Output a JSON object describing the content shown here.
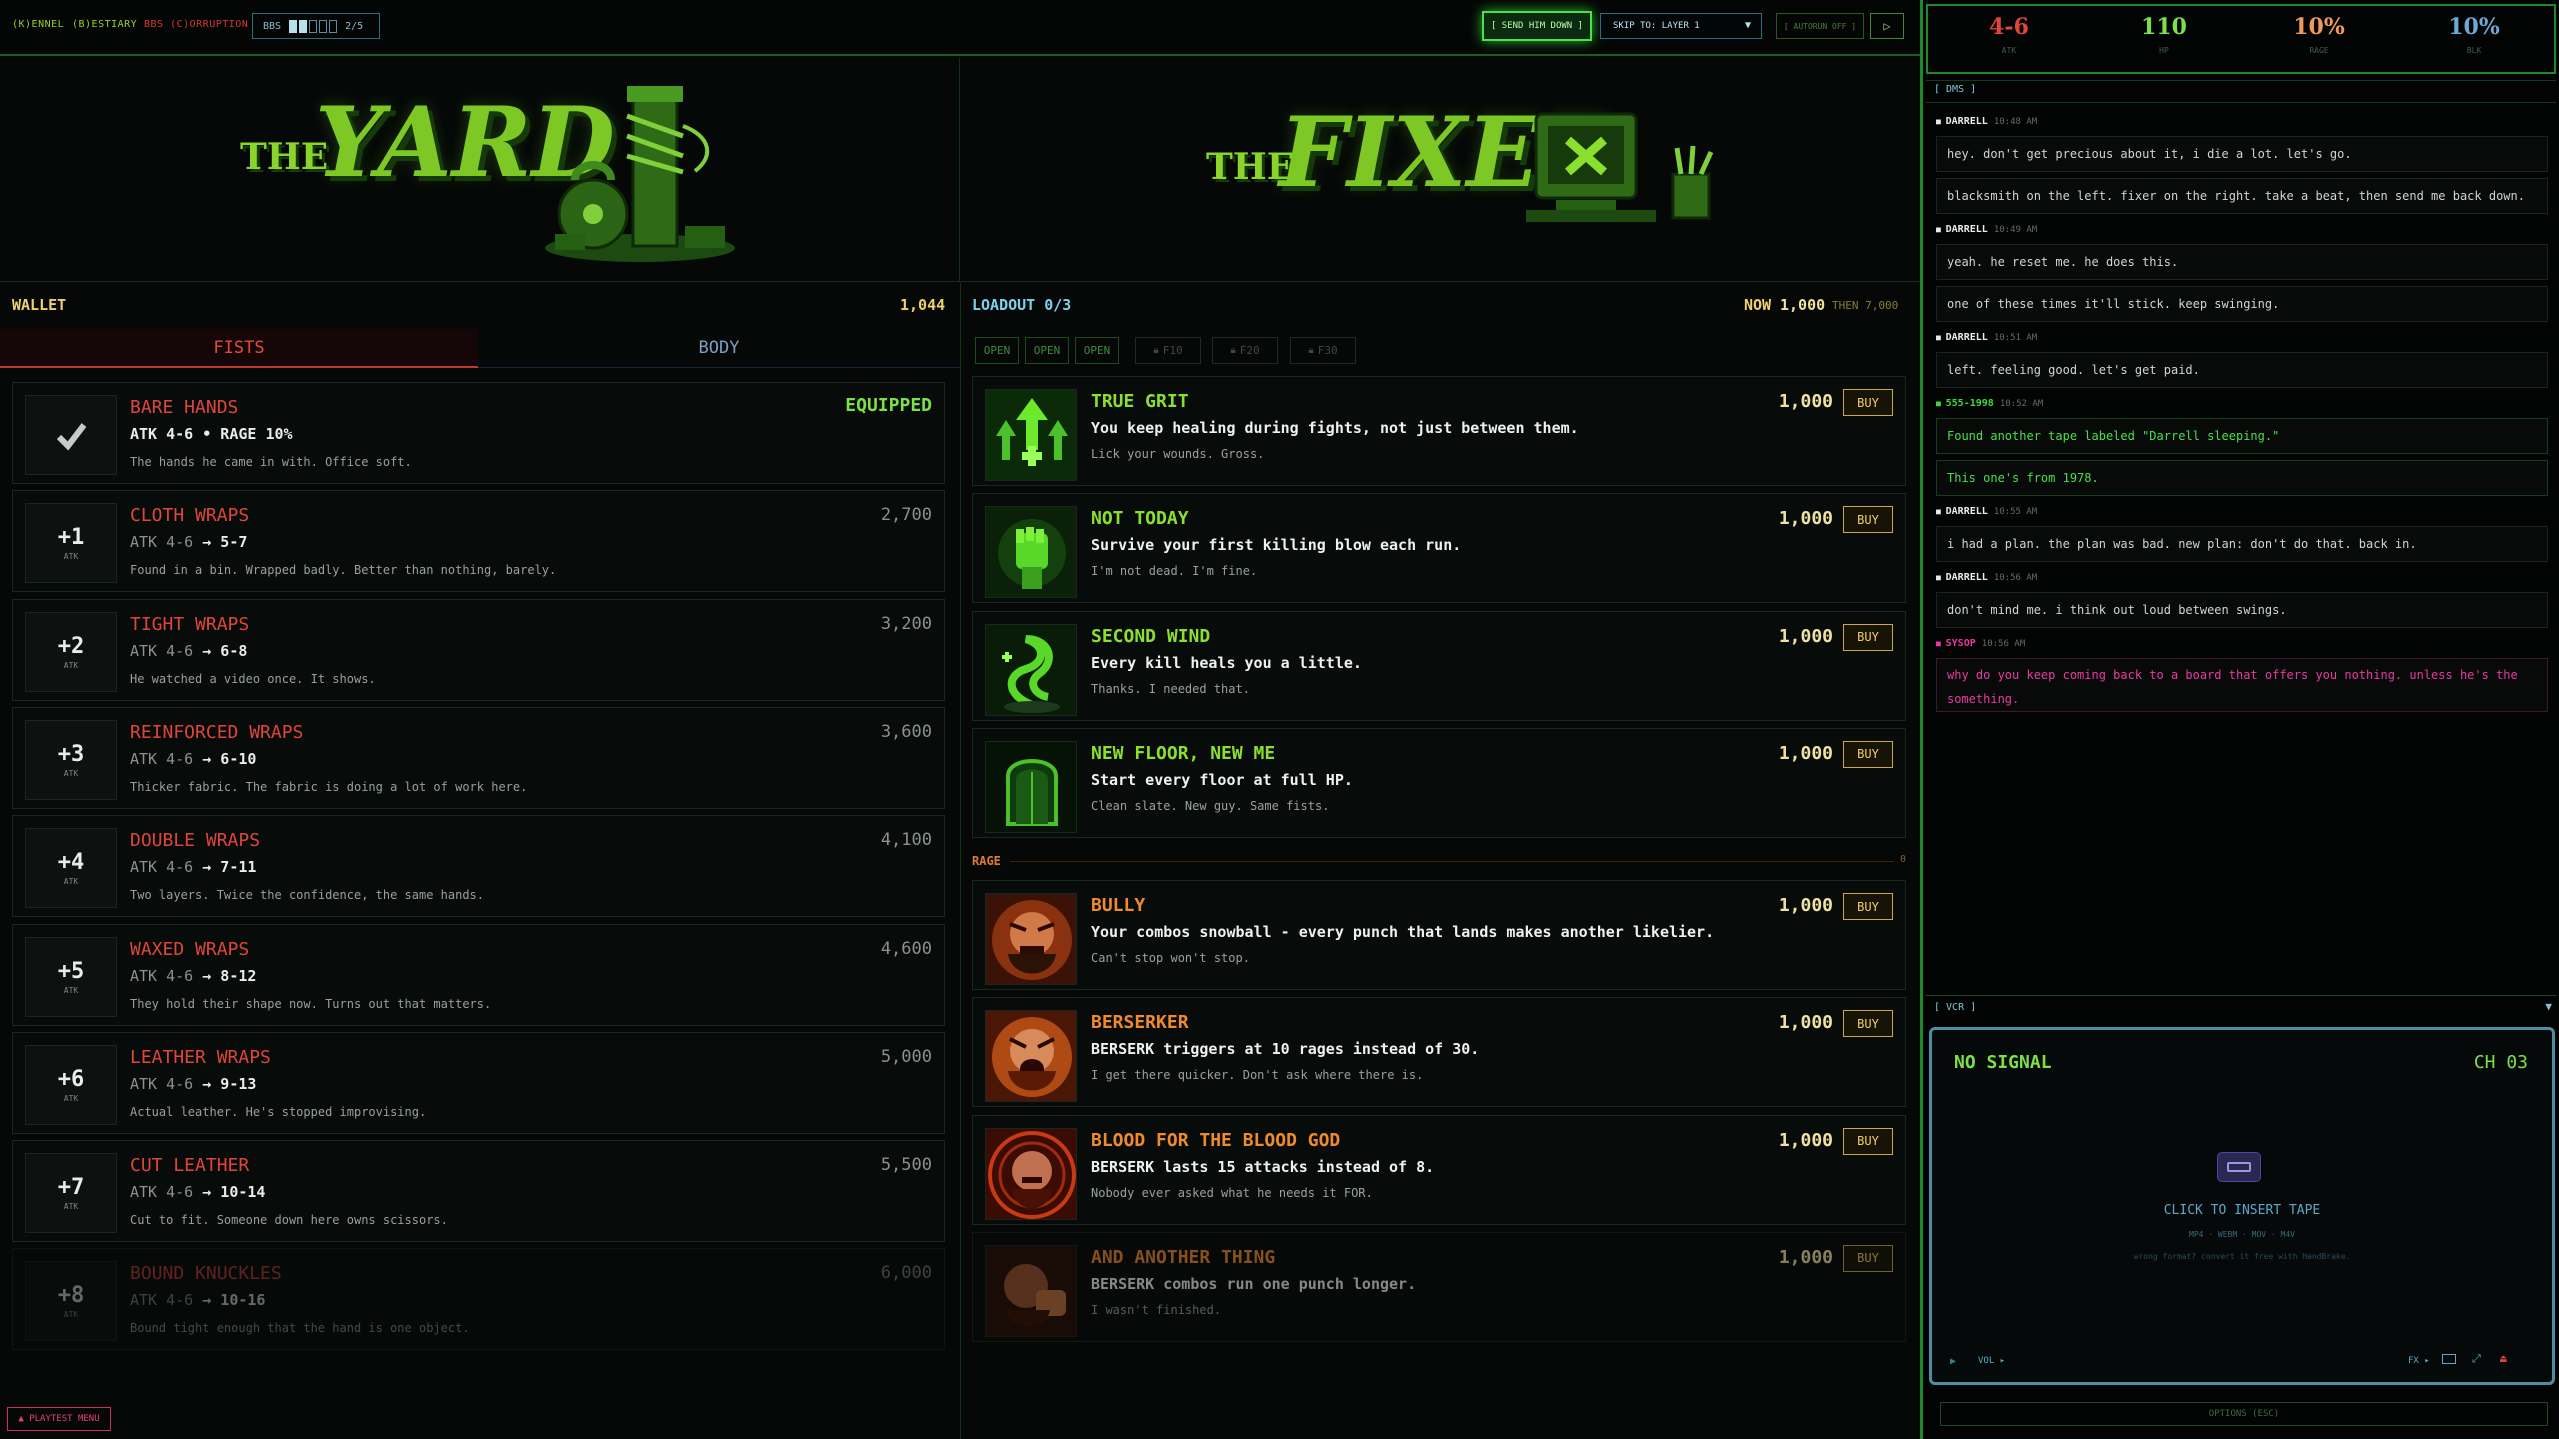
{
  "topbar": {
    "menu": [
      {
        "label": "(K)ENNEL",
        "color": "green"
      },
      {
        "label": "(B)ESTIARY",
        "color": "green"
      },
      {
        "label": "BBS (C)ORRUPTION",
        "color": "red"
      }
    ],
    "bbs_label": "BBS",
    "bbs_level": "2/5",
    "bbs_filled": 2,
    "bbs_total": 5,
    "send_button": "[ SEND HIM DOWN ]",
    "skip_select": "SKIP TO: LAYER 1",
    "autorun": "[ AUTORUN OFF ]",
    "play_icon": "play-icon"
  },
  "banners": {
    "left": {
      "the": "THE",
      "title": "YARD"
    },
    "right": {
      "the": "THE",
      "title": "FIXER"
    }
  },
  "wallet": {
    "label": "WALLET",
    "amount": "1,044"
  },
  "tabs": {
    "fists": "FISTS",
    "body": "BODY"
  },
  "weapons": [
    {
      "name": "BARE HANDS",
      "stat": "ATK 4-6 • RAGE 10%",
      "old": "",
      "new": "",
      "desc": "The hands he came in with. Office soft.",
      "price": "",
      "status": "EQUIPPED",
      "icon": "check-icon",
      "plus": "",
      "sub": ""
    },
    {
      "name": "CLOTH WRAPS",
      "stat": "",
      "old": "ATK 4-6",
      "new": "→ 5-7",
      "desc": "Found in a bin. Wrapped badly. Better than nothing, barely.",
      "price": "2,700",
      "status": "",
      "plus": "+1",
      "sub": "ATK"
    },
    {
      "name": "TIGHT WRAPS",
      "stat": "",
      "old": "ATK 4-6",
      "new": "→ 6-8",
      "desc": "He watched a video once. It shows.",
      "price": "3,200",
      "status": "",
      "plus": "+2",
      "sub": "ATK"
    },
    {
      "name": "REINFORCED WRAPS",
      "stat": "",
      "old": "ATK 4-6",
      "new": "→ 6-10",
      "desc": "Thicker fabric. The fabric is doing a lot of work here.",
      "price": "3,600",
      "status": "",
      "plus": "+3",
      "sub": "ATK"
    },
    {
      "name": "DOUBLE WRAPS",
      "stat": "",
      "old": "ATK 4-6",
      "new": "→ 7-11",
      "desc": "Two layers. Twice the confidence, the same hands.",
      "price": "4,100",
      "status": "",
      "plus": "+4",
      "sub": "ATK"
    },
    {
      "name": "WAXED WRAPS",
      "stat": "",
      "old": "ATK 4-6",
      "new": "→ 8-12",
      "desc": "They hold their shape now. Turns out that matters.",
      "price": "4,600",
      "status": "",
      "plus": "+5",
      "sub": "ATK"
    },
    {
      "name": "LEATHER WRAPS",
      "stat": "",
      "old": "ATK 4-6",
      "new": "→ 9-13",
      "desc": "Actual leather. He's stopped improvising.",
      "price": "5,000",
      "status": "",
      "plus": "+6",
      "sub": "ATK"
    },
    {
      "name": "CUT LEATHER",
      "stat": "",
      "old": "ATK 4-6",
      "new": "→ 10-14",
      "desc": "Cut to fit. Someone down here owns scissors.",
      "price": "5,500",
      "status": "",
      "plus": "+7",
      "sub": "ATK"
    },
    {
      "name": "BOUND KNUCKLES",
      "stat": "",
      "old": "ATK 4-6",
      "new": "→ 10-16",
      "desc": "Bound tight enough that the hand is one object.",
      "price": "6,000",
      "status": "",
      "plus": "+8",
      "sub": "ATK"
    }
  ],
  "loadout": {
    "label": "LOADOUT 0/3",
    "now_label": "NOW",
    "now_amount": "1,000",
    "then": "THEN 7,000",
    "slots": [
      {
        "label": "OPEN",
        "locked": false
      },
      {
        "label": "OPEN",
        "locked": false
      },
      {
        "label": "OPEN",
        "locked": false
      },
      {
        "label": "F10",
        "locked": true
      },
      {
        "label": "F20",
        "locked": true
      },
      {
        "label": "F30",
        "locked": true
      }
    ]
  },
  "perks": [
    {
      "name": "TRUE GRIT",
      "desc": "You keep healing during fights, not just between them.",
      "flavor": "Lick your wounds. Gross.",
      "price": "1,000",
      "buy": "BUY",
      "kind": "green",
      "icon": "heal-arrows-icon"
    },
    {
      "name": "NOT TODAY",
      "desc": "Survive your first killing blow each run.",
      "flavor": "I'm not dead. I'm fine.",
      "price": "1,000",
      "buy": "BUY",
      "kind": "green",
      "icon": "raised-fist-icon"
    },
    {
      "name": "SECOND WIND",
      "desc": "Every kill heals you a little.",
      "flavor": "Thanks. I needed that.",
      "price": "1,000",
      "buy": "BUY",
      "kind": "green",
      "icon": "wind-swirl-icon"
    },
    {
      "name": "NEW FLOOR, NEW ME",
      "desc": "Start every floor at full HP.",
      "flavor": "Clean slate. New guy. Same fists.",
      "price": "1,000",
      "buy": "BUY",
      "kind": "green",
      "icon": "doorway-icon"
    }
  ],
  "rage_section": {
    "label": "RAGE",
    "count": "0"
  },
  "rage_perks": [
    {
      "name": "BULLY",
      "desc": "Your combos snowball - every punch that lands makes another likelier.",
      "flavor": "Can't stop won't stop.",
      "price": "1,000",
      "buy": "BUY",
      "icon": "angry-face-icon"
    },
    {
      "name": "BERSERKER",
      "desc": "BERSERK triggers at 10 rages instead of 30.",
      "flavor": "I get there quicker. Don't ask where there is.",
      "price": "1,000",
      "buy": "BUY",
      "icon": "screaming-face-icon"
    },
    {
      "name": "BLOOD FOR THE BLOOD GOD",
      "desc": "BERSERK lasts 15 attacks instead of 8.",
      "flavor": "Nobody ever asked what he needs it FOR.",
      "price": "1,000",
      "buy": "BUY",
      "icon": "blood-face-icon"
    },
    {
      "name": "AND ANOTHER THING",
      "desc": "BERSERK combos run one punch longer.",
      "flavor": "I wasn't finished.",
      "price": "1,000",
      "buy": "BUY",
      "icon": "punch-face-icon"
    }
  ],
  "stats": [
    {
      "value": "4-6",
      "label": "ATK",
      "color": "#e0453a"
    },
    {
      "value": "110",
      "label": "HP",
      "color": "#7ce04a"
    },
    {
      "value": "10%",
      "label": "RAGE",
      "color": "#f09a5a"
    },
    {
      "value": "10%",
      "label": "BLK",
      "color": "#6fa8d8"
    }
  ],
  "dms": {
    "header": "[ DMS ]",
    "groups": [
      {
        "name": "DARRELL",
        "time": "10:48 AM",
        "nameColor": "#e6ece6",
        "messages": [
          "hey. don't get precious about it, i die a lot. let's go.",
          "blacksmith on the left. fixer on the right. take a beat, then send me back down."
        ]
      },
      {
        "name": "DARRELL",
        "time": "10:49 AM",
        "nameColor": "#e6ece6",
        "messages": [
          "yeah. he reset me. he does this.",
          "one of these times it'll stick. keep swinging."
        ]
      },
      {
        "name": "DARRELL",
        "time": "10:51 AM",
        "nameColor": "#e6ece6",
        "messages": [
          "left. feeling good. let's get paid."
        ]
      },
      {
        "name": "555-1998",
        "time": "10:52 AM",
        "nameColor": "#3fd83c",
        "messages": [
          "Found another tape labeled \"Darrell sleeping.\"",
          "This one's from 1978."
        ]
      },
      {
        "name": "DARRELL",
        "time": "10:55 AM",
        "nameColor": "#e6ece6",
        "messages": [
          "i had a plan. the plan was bad. new plan: don't do that. back in."
        ]
      },
      {
        "name": "DARRELL",
        "time": "10:56 AM",
        "nameColor": "#e6ece6",
        "messages": [
          "don't mind me. i think out loud between swings."
        ]
      },
      {
        "name": "SYSOP",
        "time": "10:56 AM",
        "nameColor": "#e83a9e",
        "messages": [
          "why do you keep coming back to a board that offers you nothing. unless he's the something."
        ]
      }
    ]
  },
  "vcr": {
    "header": "[ VCR ]",
    "collapse_icon": "triangle-down-icon",
    "status": "NO SIGNAL",
    "channel": "CH 03",
    "insert": "CLICK TO INSERT TAPE",
    "formats": "MP4 · WEBM · MOV · M4V",
    "hint": "wrong format? convert it free with HandBrake.",
    "vol": "VOL ▸",
    "fx": "FX ▸"
  },
  "options": "OPTIONS (ESC)",
  "playtest": "▲ PLAYTEST MENU"
}
